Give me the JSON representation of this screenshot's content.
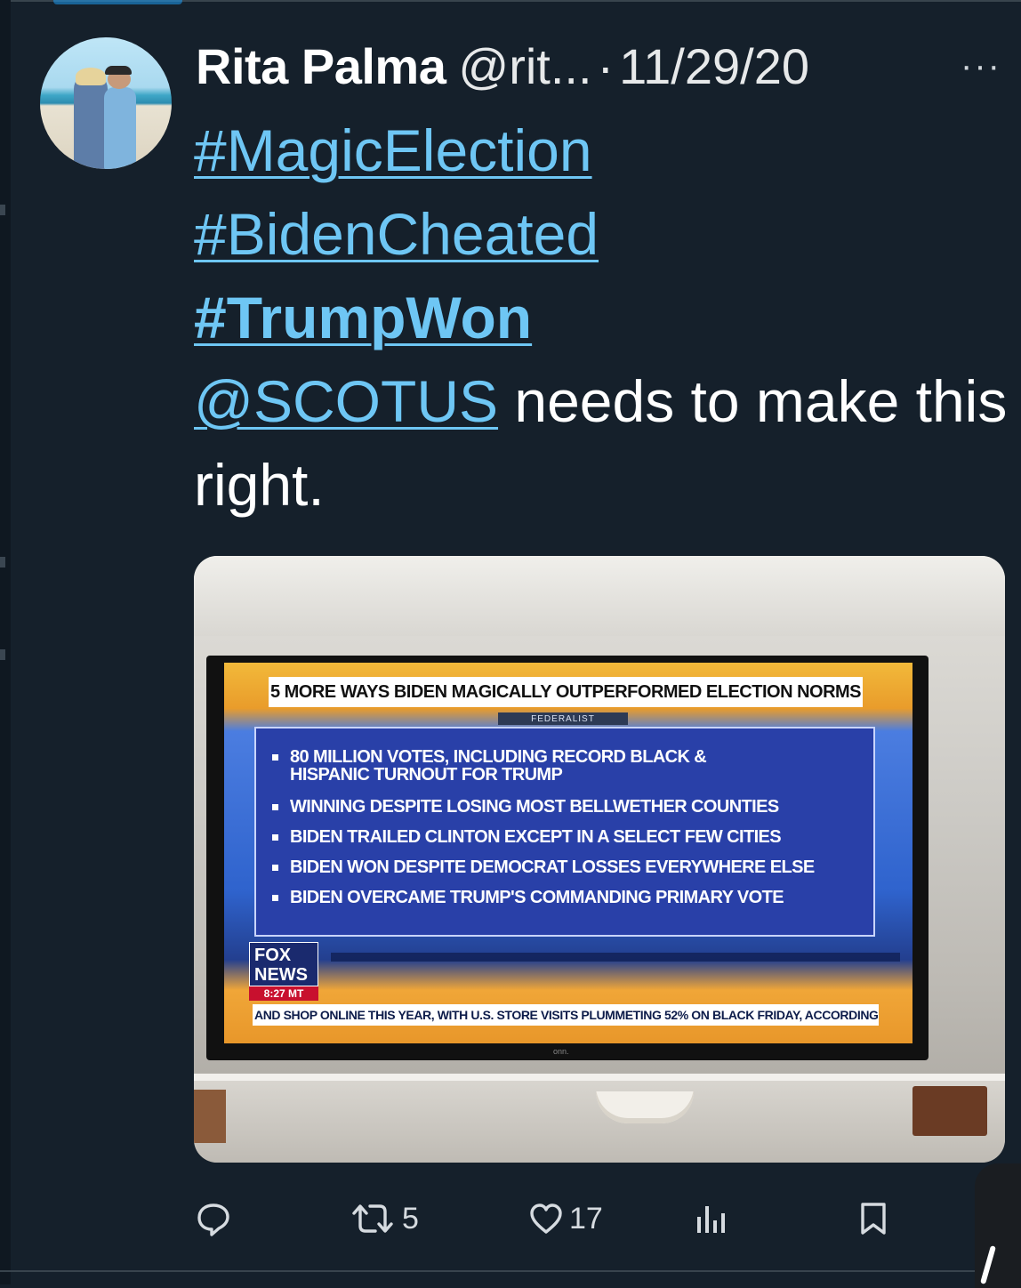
{
  "tweet": {
    "author_name": "Rita Palma",
    "handle": "@rit...",
    "separator": "·",
    "date": "11/29/20",
    "more_label": "···",
    "hashtags": [
      "#MagicElection",
      "#BidenCheated",
      "#TrumpWon"
    ],
    "mention": "@SCOTUS",
    "text_after_mention": "needs to make this right."
  },
  "media": {
    "tv_headline": "5 MORE WAYS BIDEN MAGICALLY OUTPERFORMED ELECTION NORMS",
    "source": "FEDERALIST",
    "bullets": [
      "80 MILLION VOTES, INCLUDING RECORD BLACK & HISPANIC TURNOUT FOR TRUMP",
      "WINNING DESPITE LOSING MOST BELLWETHER COUNTIES",
      "BIDEN TRAILED CLINTON EXCEPT IN A SELECT FEW CITIES",
      "BIDEN WON DESPITE DEMOCRAT LOSSES EVERYWHERE ELSE",
      "BIDEN OVERCAME TRUMP'S COMMANDING PRIMARY VOTE"
    ],
    "network_logo": "FOX NEWS",
    "clock": "8:27 MT",
    "ticker": "AND SHOP ONLINE THIS YEAR, WITH U.S. STORE VISITS PLUMMETING 52% ON BLACK FRIDAY, ACCORDING",
    "tv_brand": "onn."
  },
  "actions": {
    "reply_icon": "reply-icon",
    "retweet_count": "5",
    "like_count": "17",
    "views_icon": "views-icon",
    "bookmark_icon": "bookmark-icon"
  },
  "colors": {
    "background": "#15202b",
    "link": "#6ec6f4",
    "text": "#ffffff",
    "muted": "#d6dbe0"
  }
}
